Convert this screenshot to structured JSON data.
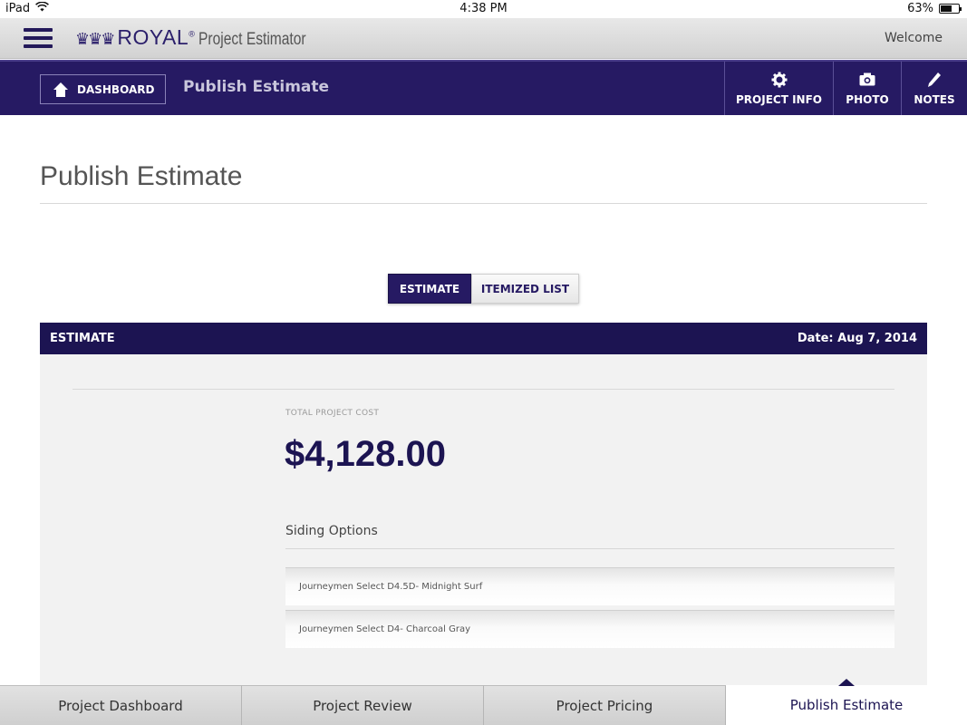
{
  "statusbar": {
    "device": "iPad",
    "time": "4:38 PM",
    "battery": "63%",
    "battery_level": 0.63
  },
  "appheader": {
    "brand": "ROYAL",
    "registered": "®",
    "product": "Project Estimator",
    "welcome": "Welcome"
  },
  "navbar": {
    "dashboard_label": "DASHBOARD",
    "title": "Publish Estimate",
    "actions": [
      {
        "label": "PROJECT INFO",
        "icon": "gear-icon"
      },
      {
        "label": "PHOTO",
        "icon": "camera-icon"
      },
      {
        "label": "NOTES",
        "icon": "pencil-icon"
      }
    ]
  },
  "page": {
    "title": "Publish Estimate"
  },
  "toggle": {
    "estimate": "ESTIMATE",
    "itemized": "ITEMIZED LIST",
    "selected": "ESTIMATE"
  },
  "estimate": {
    "header_label": "ESTIMATE",
    "date": "Date: Aug 7, 2014",
    "total_label": "TOTAL PROJECT COST",
    "total_value": "$4,128.00",
    "section_label": "Siding Options",
    "options": [
      "Journeymen Select D4.5D- Midnight Surf",
      "Journeymen Select D4- Charcoal Gray"
    ]
  },
  "tabs": [
    {
      "label": "Project Dashboard"
    },
    {
      "label": "Project Review"
    },
    {
      "label": "Project Pricing"
    },
    {
      "label": "Publish Estimate",
      "active": true
    }
  ],
  "colors": {
    "brand_purple": "#261a63",
    "header_purple": "#1c1452",
    "panel_bg": "#f2f2f2"
  }
}
